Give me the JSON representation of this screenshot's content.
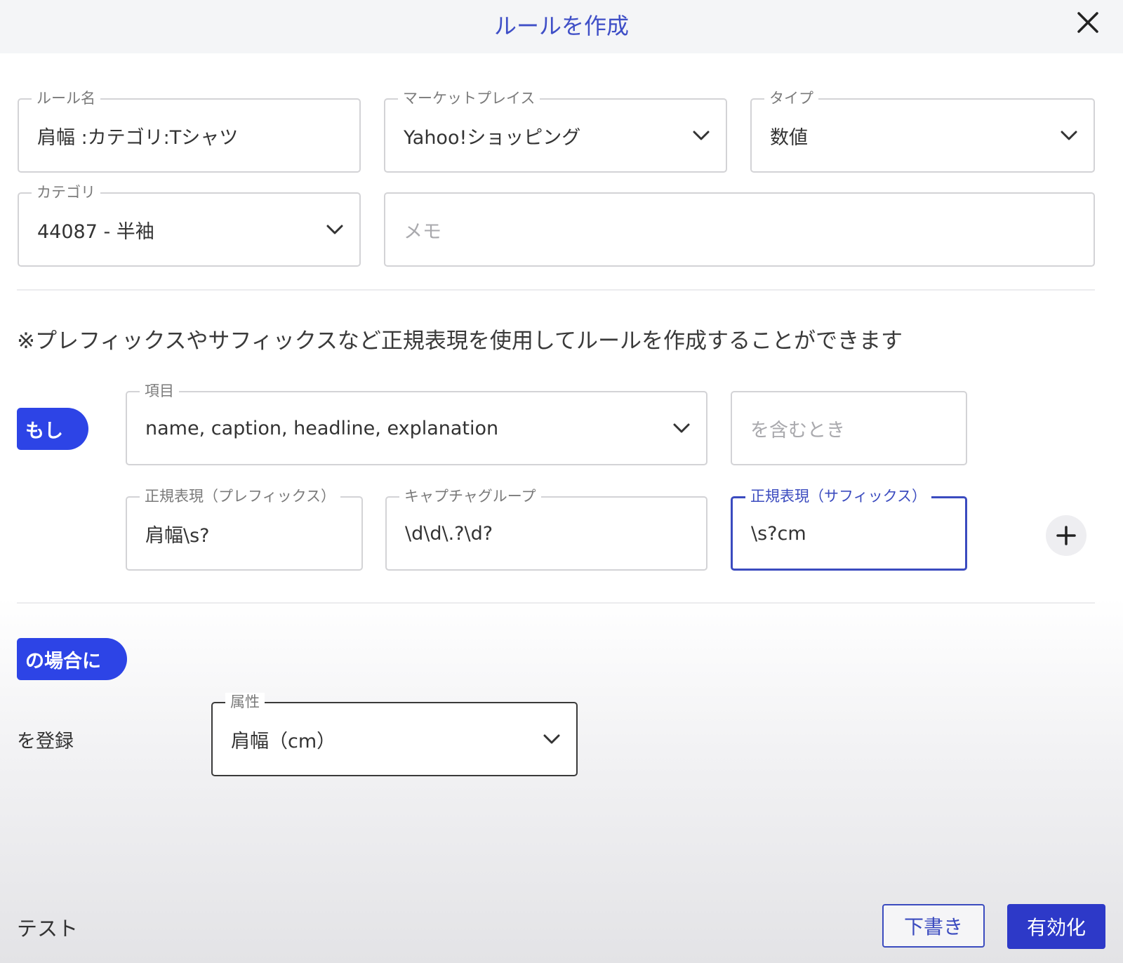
{
  "dialog": {
    "title": "ルールを作成"
  },
  "form": {
    "rule_name": {
      "label": "ルール名",
      "value": "肩幅 :カテゴリ:Tシャツ"
    },
    "marketplace": {
      "label": "マーケットプレイス",
      "value": "Yahoo!ショッピング"
    },
    "type": {
      "label": "タイプ",
      "value": "数値"
    },
    "category": {
      "label": "カテゴリ",
      "value": "44087 - 半袖"
    },
    "memo": {
      "placeholder": "メモ"
    }
  },
  "hint": "※プレフィックスやサフィックスなど正規表現を使用してルールを作成することができます",
  "condition": {
    "if_label": "もし",
    "item": {
      "label": "項目",
      "value": "name, caption, headline, explanation"
    },
    "contains": {
      "placeholder": "を含むとき"
    },
    "prefix": {
      "label": "正規表現（プレフィックス）",
      "value": "肩幅\\s?"
    },
    "capture": {
      "label": "キャプチャグループ",
      "value": "\\d\\d\\.?\\d?"
    },
    "suffix": {
      "label": "正規表現（サフィックス）",
      "value": "\\s?cm"
    }
  },
  "action": {
    "case_label": "の場合に",
    "register_label": "を登録",
    "attribute": {
      "label": "属性",
      "value": "肩幅（cm）"
    }
  },
  "footer": {
    "test_label": "テスト",
    "draft_button": "下書き",
    "enable_button": "有効化"
  },
  "colors": {
    "accent": "#3b4bbf",
    "pill": "#2d44e6",
    "primary_button": "#2d39c8"
  },
  "icons": {
    "close": "close-icon",
    "dropdown": "chevron-down-icon",
    "add": "plus-icon"
  }
}
